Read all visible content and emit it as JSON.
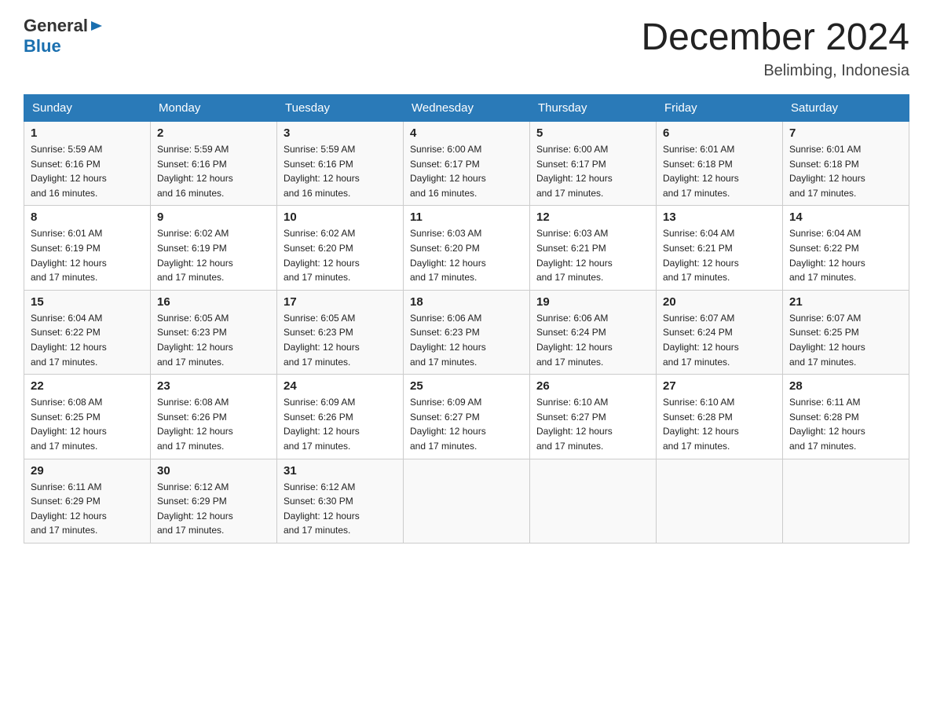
{
  "header": {
    "title": "December 2024",
    "location": "Belimbing, Indonesia",
    "logo_general": "General",
    "logo_blue": "Blue"
  },
  "days_of_week": [
    "Sunday",
    "Monday",
    "Tuesday",
    "Wednesday",
    "Thursday",
    "Friday",
    "Saturday"
  ],
  "weeks": [
    [
      {
        "day": "1",
        "sunrise": "5:59 AM",
        "sunset": "6:16 PM",
        "daylight": "12 hours and 16 minutes."
      },
      {
        "day": "2",
        "sunrise": "5:59 AM",
        "sunset": "6:16 PM",
        "daylight": "12 hours and 16 minutes."
      },
      {
        "day": "3",
        "sunrise": "5:59 AM",
        "sunset": "6:16 PM",
        "daylight": "12 hours and 16 minutes."
      },
      {
        "day": "4",
        "sunrise": "6:00 AM",
        "sunset": "6:17 PM",
        "daylight": "12 hours and 16 minutes."
      },
      {
        "day": "5",
        "sunrise": "6:00 AM",
        "sunset": "6:17 PM",
        "daylight": "12 hours and 17 minutes."
      },
      {
        "day": "6",
        "sunrise": "6:01 AM",
        "sunset": "6:18 PM",
        "daylight": "12 hours and 17 minutes."
      },
      {
        "day": "7",
        "sunrise": "6:01 AM",
        "sunset": "6:18 PM",
        "daylight": "12 hours and 17 minutes."
      }
    ],
    [
      {
        "day": "8",
        "sunrise": "6:01 AM",
        "sunset": "6:19 PM",
        "daylight": "12 hours and 17 minutes."
      },
      {
        "day": "9",
        "sunrise": "6:02 AM",
        "sunset": "6:19 PM",
        "daylight": "12 hours and 17 minutes."
      },
      {
        "day": "10",
        "sunrise": "6:02 AM",
        "sunset": "6:20 PM",
        "daylight": "12 hours and 17 minutes."
      },
      {
        "day": "11",
        "sunrise": "6:03 AM",
        "sunset": "6:20 PM",
        "daylight": "12 hours and 17 minutes."
      },
      {
        "day": "12",
        "sunrise": "6:03 AM",
        "sunset": "6:21 PM",
        "daylight": "12 hours and 17 minutes."
      },
      {
        "day": "13",
        "sunrise": "6:04 AM",
        "sunset": "6:21 PM",
        "daylight": "12 hours and 17 minutes."
      },
      {
        "day": "14",
        "sunrise": "6:04 AM",
        "sunset": "6:22 PM",
        "daylight": "12 hours and 17 minutes."
      }
    ],
    [
      {
        "day": "15",
        "sunrise": "6:04 AM",
        "sunset": "6:22 PM",
        "daylight": "12 hours and 17 minutes."
      },
      {
        "day": "16",
        "sunrise": "6:05 AM",
        "sunset": "6:23 PM",
        "daylight": "12 hours and 17 minutes."
      },
      {
        "day": "17",
        "sunrise": "6:05 AM",
        "sunset": "6:23 PM",
        "daylight": "12 hours and 17 minutes."
      },
      {
        "day": "18",
        "sunrise": "6:06 AM",
        "sunset": "6:23 PM",
        "daylight": "12 hours and 17 minutes."
      },
      {
        "day": "19",
        "sunrise": "6:06 AM",
        "sunset": "6:24 PM",
        "daylight": "12 hours and 17 minutes."
      },
      {
        "day": "20",
        "sunrise": "6:07 AM",
        "sunset": "6:24 PM",
        "daylight": "12 hours and 17 minutes."
      },
      {
        "day": "21",
        "sunrise": "6:07 AM",
        "sunset": "6:25 PM",
        "daylight": "12 hours and 17 minutes."
      }
    ],
    [
      {
        "day": "22",
        "sunrise": "6:08 AM",
        "sunset": "6:25 PM",
        "daylight": "12 hours and 17 minutes."
      },
      {
        "day": "23",
        "sunrise": "6:08 AM",
        "sunset": "6:26 PM",
        "daylight": "12 hours and 17 minutes."
      },
      {
        "day": "24",
        "sunrise": "6:09 AM",
        "sunset": "6:26 PM",
        "daylight": "12 hours and 17 minutes."
      },
      {
        "day": "25",
        "sunrise": "6:09 AM",
        "sunset": "6:27 PM",
        "daylight": "12 hours and 17 minutes."
      },
      {
        "day": "26",
        "sunrise": "6:10 AM",
        "sunset": "6:27 PM",
        "daylight": "12 hours and 17 minutes."
      },
      {
        "day": "27",
        "sunrise": "6:10 AM",
        "sunset": "6:28 PM",
        "daylight": "12 hours and 17 minutes."
      },
      {
        "day": "28",
        "sunrise": "6:11 AM",
        "sunset": "6:28 PM",
        "daylight": "12 hours and 17 minutes."
      }
    ],
    [
      {
        "day": "29",
        "sunrise": "6:11 AM",
        "sunset": "6:29 PM",
        "daylight": "12 hours and 17 minutes."
      },
      {
        "day": "30",
        "sunrise": "6:12 AM",
        "sunset": "6:29 PM",
        "daylight": "12 hours and 17 minutes."
      },
      {
        "day": "31",
        "sunrise": "6:12 AM",
        "sunset": "6:30 PM",
        "daylight": "12 hours and 17 minutes."
      },
      null,
      null,
      null,
      null
    ]
  ],
  "labels": {
    "sunrise": "Sunrise:",
    "sunset": "Sunset:",
    "daylight": "Daylight:"
  },
  "colors": {
    "header_bg": "#2a7ab8",
    "header_text": "#ffffff",
    "title_color": "#222222",
    "logo_blue": "#1a6faf"
  }
}
